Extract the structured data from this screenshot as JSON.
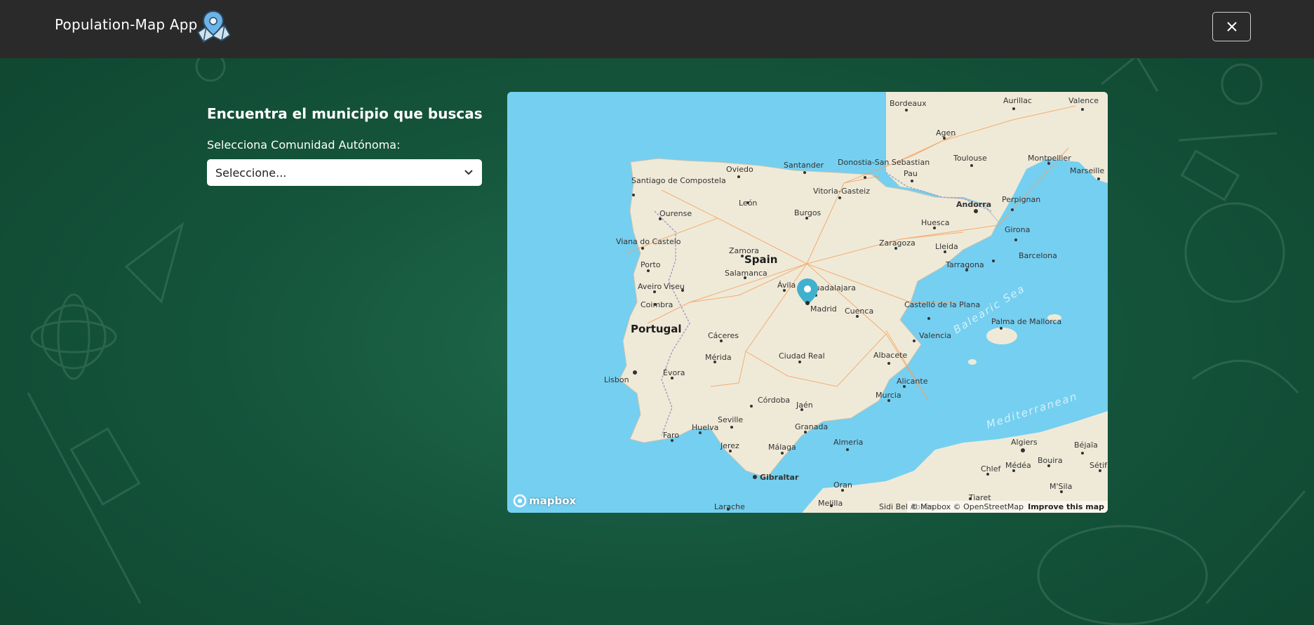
{
  "header": {
    "app_title": "Population-Map App",
    "logo_icon": "map-pin-logo-icon",
    "close_icon": "close-icon"
  },
  "panel": {
    "title": "Encuentra el municipio que buscas",
    "select_label": "Selecciona Comunidad Autónoma:",
    "select_value": "Seleccione..."
  },
  "map": {
    "countries": [
      "Spain",
      "Portugal"
    ],
    "seas": [
      "Balearic Sea",
      "Mediterranean"
    ],
    "marker": "Madrid",
    "cities": [
      "Bordeaux",
      "Aurillac",
      "Valence",
      "Agen",
      "Toulouse",
      "Montpellier",
      "Marseille",
      "Santander",
      "Donostia-San Sebastian",
      "Oviedo",
      "Pau",
      "Santiago de Compostela",
      "Vitoria-Gasteiz",
      "León",
      "Andorra",
      "Perpignan",
      "Ourense",
      "Burgos",
      "Huesca",
      "Girona",
      "Viana do Castelo",
      "Zaragoza",
      "Lleida",
      "Zamora",
      "Porto",
      "Barcelona",
      "Salamanca",
      "Tarragona",
      "Ávila",
      "Guadalajara",
      "Aveiro",
      "Viseu",
      "Coimbra",
      "Madrid",
      "Cuenca",
      "Castelló de la Plana",
      "Palma de Mallorca",
      "Cáceres",
      "Valencia",
      "Mérida",
      "Ciudad Real",
      "Albacete",
      "Lisbon",
      "Évora",
      "Alicante",
      "Murcia",
      "Córdoba",
      "Jaén",
      "Seville",
      "Huelva",
      "Granada",
      "Almeria",
      "Faro",
      "Jerez",
      "Málaga",
      "Algiers",
      "Béjaïa",
      "Chlef",
      "Médéa",
      "Bouira",
      "Sétif",
      "Gibraltar",
      "Oran",
      "M'Sila",
      "Tiaret",
      "Melilla",
      "Larache",
      "Sidi Bel Abbès"
    ],
    "attribution": "© Mapbox © OpenStreetMap",
    "improve_link": "Improve this map",
    "brand": "mapbox",
    "colors": {
      "water": "#75cff0",
      "land": "#efead8",
      "roads": "#f4a261",
      "marker": "#3fb1ce"
    }
  }
}
